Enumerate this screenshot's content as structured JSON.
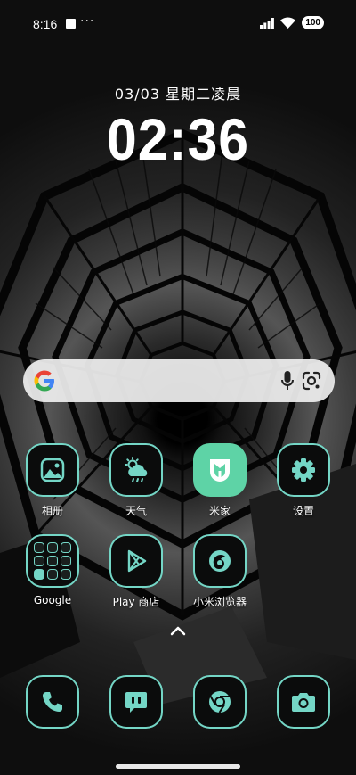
{
  "status_bar": {
    "time": "8:16",
    "more": "···",
    "battery": "100"
  },
  "clock": {
    "date": "03/03  星期二凌晨",
    "time": "02:36"
  },
  "search": {
    "g": "G"
  },
  "apps": {
    "gallery": "相册",
    "weather": "天气",
    "mijia": "米家",
    "settings": "设置",
    "google_folder": "Google",
    "play_store": "Play 商店",
    "mi_browser": "小米浏览器"
  },
  "colors": {
    "icon_outline": "#74d6c6",
    "mijia_bg": "#5ed3a6",
    "search_bg": "#eeeeee"
  }
}
